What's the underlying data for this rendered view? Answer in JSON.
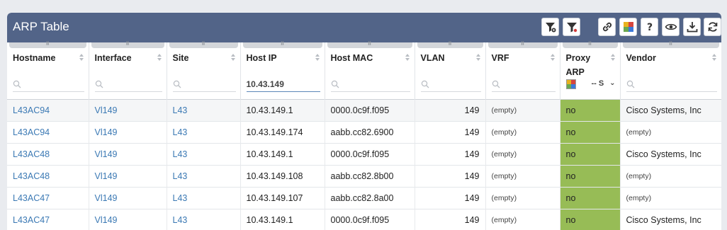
{
  "title": "ARP Table",
  "colors": {
    "titlebar": "#526488",
    "link": "#3b79b4",
    "proxy_no": "#97bc56"
  },
  "toolbar": {
    "icons": [
      "filter-settings-icon",
      "filter-clear-icon",
      "link-icon",
      "color-legend-icon",
      "help-icon",
      "view-icon",
      "download-icon",
      "refresh-icon"
    ]
  },
  "columns": [
    {
      "label": "Hostname"
    },
    {
      "label": "Interface"
    },
    {
      "label": "Site"
    },
    {
      "label": "Host IP",
      "filter_value": "10.43.149"
    },
    {
      "label": "Host MAC"
    },
    {
      "label": "VLAN"
    },
    {
      "label": "VRF"
    },
    {
      "label": "Proxy ARP",
      "select_value": "-- S"
    },
    {
      "label": "Vendor"
    }
  ],
  "rows": [
    {
      "hostname": "L43AC94",
      "interface": "Vl149",
      "site": "L43",
      "host_ip": "10.43.149.1",
      "host_mac": "0000.0c9f.f095",
      "vlan": "149",
      "vrf": "(empty)",
      "proxy_arp": "no",
      "vendor": "Cisco Systems, Inc"
    },
    {
      "hostname": "L43AC94",
      "interface": "Vl149",
      "site": "L43",
      "host_ip": "10.43.149.174",
      "host_mac": "aabb.cc82.6900",
      "vlan": "149",
      "vrf": "(empty)",
      "proxy_arp": "no",
      "vendor": "(empty)"
    },
    {
      "hostname": "L43AC48",
      "interface": "Vl149",
      "site": "L43",
      "host_ip": "10.43.149.1",
      "host_mac": "0000.0c9f.f095",
      "vlan": "149",
      "vrf": "(empty)",
      "proxy_arp": "no",
      "vendor": "Cisco Systems, Inc"
    },
    {
      "hostname": "L43AC48",
      "interface": "Vl149",
      "site": "L43",
      "host_ip": "10.43.149.108",
      "host_mac": "aabb.cc82.8b00",
      "vlan": "149",
      "vrf": "(empty)",
      "proxy_arp": "no",
      "vendor": "(empty)"
    },
    {
      "hostname": "L43AC47",
      "interface": "Vl149",
      "site": "L43",
      "host_ip": "10.43.149.107",
      "host_mac": "aabb.cc82.8a00",
      "vlan": "149",
      "vrf": "(empty)",
      "proxy_arp": "no",
      "vendor": "(empty)"
    },
    {
      "hostname": "L43AC47",
      "interface": "Vl149",
      "site": "L43",
      "host_ip": "10.43.149.1",
      "host_mac": "0000.0c9f.f095",
      "vlan": "149",
      "vrf": "(empty)",
      "proxy_arp": "no",
      "vendor": "Cisco Systems, Inc"
    }
  ]
}
